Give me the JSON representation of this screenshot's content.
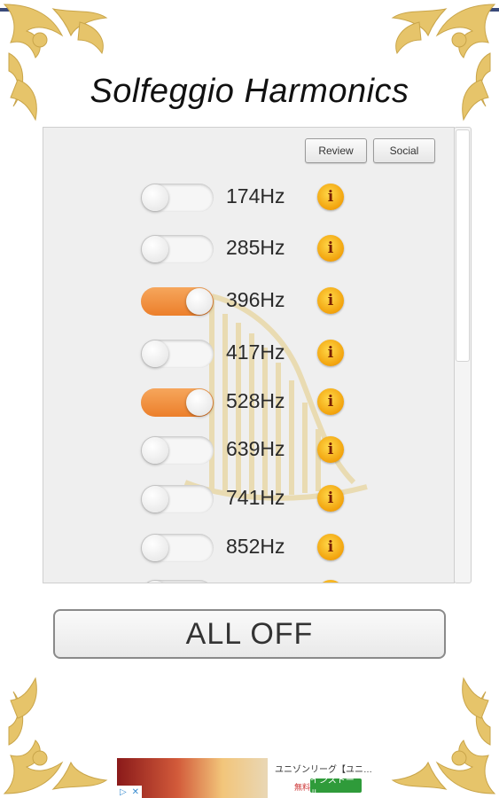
{
  "app": {
    "title": "Solfeggio Harmonics"
  },
  "toolbar": {
    "review_label": "Review",
    "social_label": "Social"
  },
  "frequencies": [
    {
      "label": "174Hz",
      "on": false
    },
    {
      "label": "285Hz",
      "on": false
    },
    {
      "label": "396Hz",
      "on": true
    },
    {
      "label": "417Hz",
      "on": false
    },
    {
      "label": "528Hz",
      "on": true
    },
    {
      "label": "639Hz",
      "on": false
    },
    {
      "label": "741Hz",
      "on": false
    },
    {
      "label": "852Hz",
      "on": false
    }
  ],
  "all_off_label": "ALL OFF",
  "ad": {
    "text": "ユニゾンリーグ【ユニ…",
    "free": "無料",
    "install": "インストール"
  },
  "colors": {
    "accent": "#ec7f2b",
    "ornament": "#e6c46a",
    "info": "#f2a20c"
  },
  "icons": {
    "info": "info-icon",
    "ornament": "ornament-icon",
    "harp": "harp-watermark-icon"
  }
}
